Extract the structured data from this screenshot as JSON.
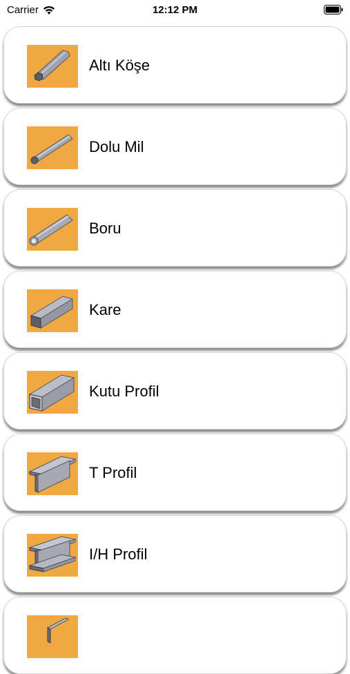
{
  "status_bar": {
    "carrier": "Carrier",
    "time": "12:12 PM"
  },
  "profiles": [
    {
      "label": "Altı Köşe",
      "icon": "hexagonal-bar-icon"
    },
    {
      "label": "Dolu Mil",
      "icon": "solid-round-bar-icon"
    },
    {
      "label": "Boru",
      "icon": "pipe-icon"
    },
    {
      "label": "Kare",
      "icon": "square-bar-icon"
    },
    {
      "label": "Kutu Profil",
      "icon": "box-profile-icon"
    },
    {
      "label": "T Profil",
      "icon": "t-profile-icon"
    },
    {
      "label": "I/H Profil",
      "icon": "ih-profile-icon"
    },
    {
      "label": "",
      "icon": "angle-profile-icon"
    }
  ],
  "colors": {
    "thumbnail_background": "#f0a942",
    "metal": "#a9abb5"
  }
}
